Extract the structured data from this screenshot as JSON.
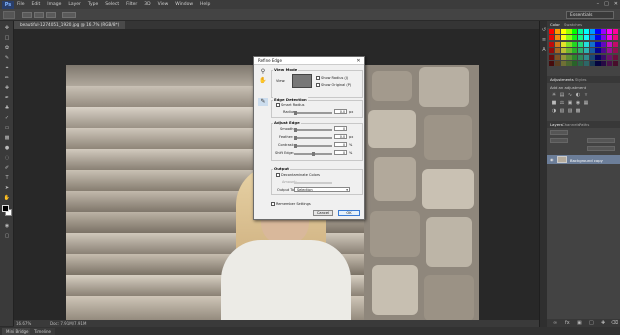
{
  "menu": [
    "File",
    "Edit",
    "Image",
    "Layer",
    "Type",
    "Select",
    "Filter",
    "3D",
    "View",
    "Window",
    "Help"
  ],
  "app_logo": "Ps",
  "workspace": "Essentials",
  "document": {
    "tab_label": "beautiful-1274051_1920.jpg @ 16.7% (RGB/8*)"
  },
  "status": {
    "zoom": "16.67%",
    "doc": "Doc: 7.91M/7.91M"
  },
  "bottom_tabs": [
    "Mini Bridge",
    "Timeline"
  ],
  "panels": {
    "color_tabs": [
      "Color",
      "Swatches"
    ],
    "adjustments_tabs": [
      "Adjustments",
      "Styles"
    ],
    "adjustments_header": "Add an adjustment",
    "layers_tabs": [
      "Layers",
      "Channels",
      "Paths"
    ],
    "layer_name": "Background copy"
  },
  "dialog": {
    "title": "Refine Edge",
    "view_mode": {
      "title": "View Mode",
      "view_label": "View:",
      "show_radius": "Show Radius (J)",
      "show_original": "Show Original (P)"
    },
    "edge_detection": {
      "title": "Edge Detection",
      "smart_radius": "Smart Radius",
      "radius_label": "Radius:",
      "radius_value": "0.0",
      "radius_unit": "px"
    },
    "adjust_edge": {
      "title": "Adjust Edge",
      "rows": [
        {
          "label": "Smooth:",
          "value": "0",
          "unit": ""
        },
        {
          "label": "Feather:",
          "value": "0.0",
          "unit": "px"
        },
        {
          "label": "Contrast:",
          "value": "0",
          "unit": "%"
        },
        {
          "label": "Shift Edge:",
          "value": "0",
          "unit": "%"
        }
      ]
    },
    "output": {
      "title": "Output",
      "decontaminate": "Decontaminate Colors",
      "amount_label": "Amount:",
      "output_to_label": "Output To:",
      "output_to_value": "Selection"
    },
    "remember": "Remember Settings",
    "cancel": "Cancel",
    "ok": "OK"
  }
}
